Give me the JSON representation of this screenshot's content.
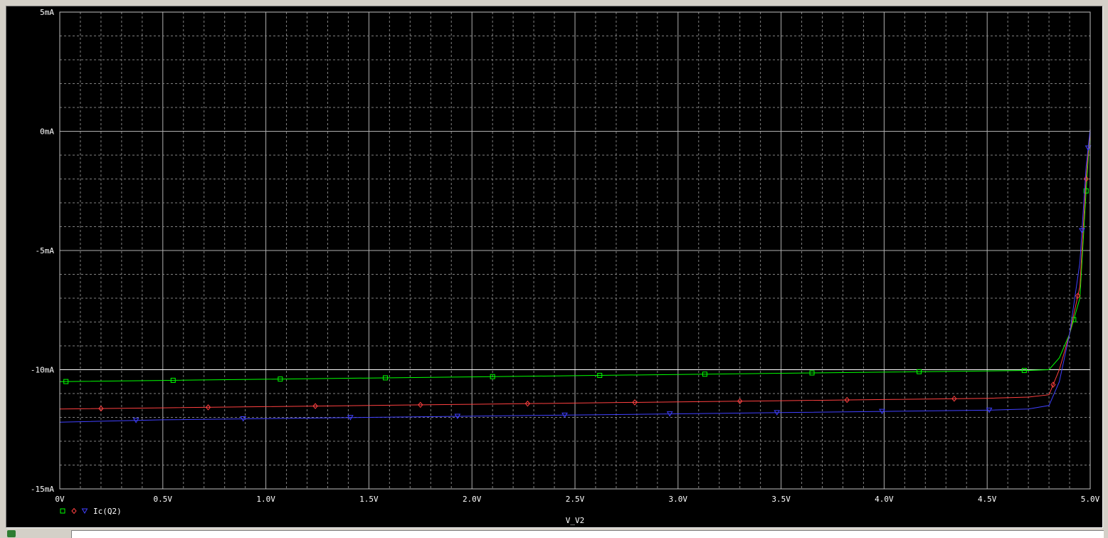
{
  "chart_data": {
    "type": "line",
    "xlabel": "V_V2",
    "x_ticks": [
      "0V",
      "0.5V",
      "1.0V",
      "1.5V",
      "2.0V",
      "2.5V",
      "3.0V",
      "3.5V",
      "4.0V",
      "4.5V",
      "5.0V"
    ],
    "y_ticks": [
      "5mA",
      "0mA",
      "-5mA",
      "-10mA",
      "-15mA"
    ],
    "xlim": [
      0,
      5.0
    ],
    "ylim": [
      -15,
      5
    ],
    "y_unit": "mA",
    "grid": true,
    "legend_position": "bottom-left",
    "legend_label": "Ic(Q2)",
    "reference_line_y": -10,
    "series": [
      {
        "marker": "square",
        "color": "#00ff00",
        "x": [
          0,
          0.5,
          1.0,
          1.5,
          2.0,
          2.5,
          3.0,
          3.5,
          4.0,
          4.5,
          4.7,
          4.8,
          4.85,
          4.9,
          4.95,
          4.98,
          5.0
        ],
        "y": [
          -10.5,
          -10.45,
          -10.4,
          -10.35,
          -10.3,
          -10.25,
          -10.2,
          -10.15,
          -10.1,
          -10.05,
          -10.03,
          -10.0,
          -9.5,
          -8.5,
          -7.0,
          -2.5,
          0.1
        ],
        "marker_x": [
          0.03,
          0.55,
          1.07,
          1.58,
          2.1,
          2.62,
          3.13,
          3.65,
          4.17,
          4.68,
          4.92,
          4.98
        ]
      },
      {
        "marker": "diamond",
        "color": "#ff4040",
        "x": [
          0,
          0.5,
          1.0,
          1.5,
          2.0,
          2.5,
          3.0,
          3.5,
          4.0,
          4.5,
          4.7,
          4.8,
          4.85,
          4.9,
          4.95,
          4.98,
          5.0
        ],
        "y": [
          -11.65,
          -11.6,
          -11.55,
          -11.5,
          -11.45,
          -11.4,
          -11.35,
          -11.3,
          -11.25,
          -11.2,
          -11.15,
          -11.05,
          -10.0,
          -8.5,
          -6.5,
          -2.0,
          0.1
        ],
        "marker_x": [
          0.2,
          0.72,
          1.24,
          1.75,
          2.27,
          2.79,
          3.3,
          3.82,
          4.34,
          4.82,
          4.94,
          4.98
        ]
      },
      {
        "marker": "triangle",
        "color": "#4040ff",
        "x": [
          0,
          0.5,
          1.0,
          1.5,
          2.0,
          2.5,
          3.0,
          3.5,
          4.0,
          4.5,
          4.7,
          4.8,
          4.85,
          4.9,
          4.95,
          4.98,
          5.0
        ],
        "y": [
          -12.2,
          -12.1,
          -12.05,
          -12.0,
          -11.95,
          -11.9,
          -11.85,
          -11.8,
          -11.75,
          -11.7,
          -11.65,
          -11.5,
          -10.5,
          -8.5,
          -5.5,
          -1.5,
          0.1
        ],
        "marker_x": [
          0.37,
          0.89,
          1.41,
          1.93,
          2.45,
          2.96,
          3.48,
          3.99,
          4.51,
          4.96,
          4.99
        ]
      }
    ]
  }
}
